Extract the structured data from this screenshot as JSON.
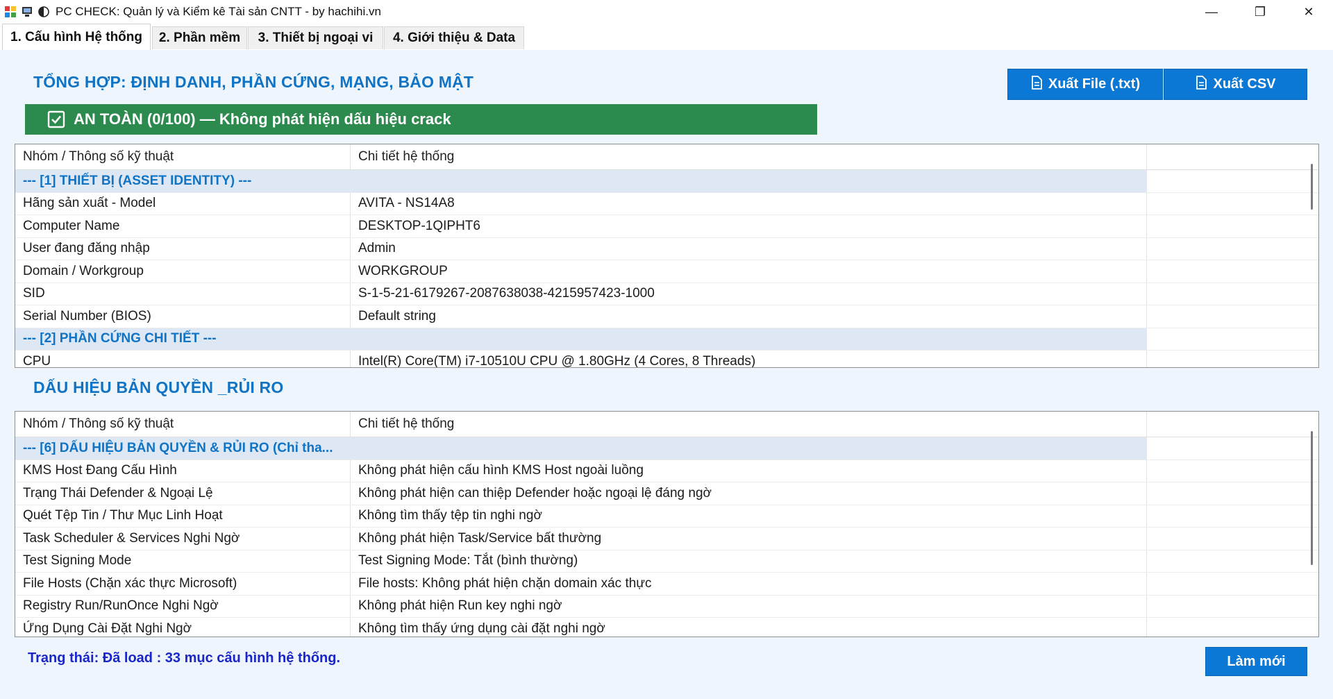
{
  "window": {
    "title": "PC CHECK: Quản lý và Kiểm kê Tài sản CNTT - by hachihi.vn",
    "controls": {
      "minimize": "—",
      "maximize": "❐",
      "close": "✕"
    }
  },
  "tabs": [
    {
      "label": "1. Cấu hình Hệ thống",
      "active": true
    },
    {
      "label": "2. Phần mềm",
      "active": false
    },
    {
      "label": "3. Thiết bị ngoại vi",
      "active": false
    },
    {
      "label": "4. Giới thiệu & Data",
      "active": false
    }
  ],
  "summary": {
    "title": "TỔNG HỢP: ĐỊNH DANH, PHẦN CỨNG, MẠNG, BẢO MẬT",
    "export_txt_label": "Xuất File (.txt)",
    "export_csv_label": "Xuất CSV",
    "safety_banner": "AN TOÀN (0/100) — Không phát hiện dấu hiệu crack",
    "columns": [
      "Nhóm / Thông số kỹ thuật",
      "Chi tiết hệ thống"
    ],
    "rows": [
      {
        "group": true,
        "name": "--- [1] THIẾT BỊ (ASSET IDENTITY) ---",
        "value": ""
      },
      {
        "group": false,
        "name": "Hãng sản xuất - Model",
        "value": "AVITA - NS14A8"
      },
      {
        "group": false,
        "name": "Computer Name",
        "value": "DESKTOP-1QIPHT6"
      },
      {
        "group": false,
        "name": "User đang đăng nhập",
        "value": "Admin"
      },
      {
        "group": false,
        "name": "Domain / Workgroup",
        "value": "WORKGROUP"
      },
      {
        "group": false,
        "name": "SID",
        "value": "S-1-5-21-6179267-2087638038-4215957423-1000"
      },
      {
        "group": false,
        "name": "Serial Number (BIOS)",
        "value": "Default string"
      },
      {
        "group": true,
        "name": "--- [2] PHẦN CỨNG CHI TIẾT ---",
        "value": ""
      },
      {
        "group": false,
        "name": "CPU",
        "value": "Intel(R) Core(TM) i7-10510U CPU @ 1.80GHz (4 Cores, 8 Threads)"
      }
    ]
  },
  "license": {
    "title": "DẤU HIỆU BẢN QUYỀN _RỦI RO",
    "columns": [
      "Nhóm / Thông số kỹ thuật",
      "Chi tiết hệ thống"
    ],
    "rows": [
      {
        "group": true,
        "name": "--- [6] DẤU HIỆU BẢN QUYỀN & RỦI RO (Chỉ tha...",
        "value": ""
      },
      {
        "group": false,
        "name": "KMS Host Đang Cấu Hình",
        "value": "Không phát hiện cấu hình KMS Host ngoài luồng"
      },
      {
        "group": false,
        "name": "Trạng Thái Defender & Ngoại Lệ",
        "value": "Không phát hiện can thiệp Defender hoặc ngoại lệ đáng ngờ"
      },
      {
        "group": false,
        "name": "Quét Tệp Tin / Thư Mục Linh Hoạt",
        "value": "Không tìm thấy tệp tin nghi ngờ"
      },
      {
        "group": false,
        "name": "Task Scheduler & Services Nghi Ngờ",
        "value": "Không phát hiện Task/Service bất thường"
      },
      {
        "group": false,
        "name": "Test Signing Mode",
        "value": "Test Signing Mode: Tắt (bình thường)"
      },
      {
        "group": false,
        "name": "File Hosts (Chặn xác thực Microsoft)",
        "value": "File hosts: Không phát hiện chặn domain xác thực"
      },
      {
        "group": false,
        "name": "Registry Run/RunOnce Nghi Ngờ",
        "value": "Không phát hiện Run key nghi ngờ"
      },
      {
        "group": false,
        "name": "Ứng Dụng Cài Đặt Nghi Ngờ",
        "value": "Không tìm thấy ứng dụng cài đặt nghi ngờ"
      }
    ]
  },
  "footer": {
    "status": "Trạng thái: Đã load : 33 mục cấu hình hệ thống.",
    "refresh_label": "Làm mới"
  },
  "colors": {
    "accent": "#0a78d4",
    "title_blue": "#1173c4",
    "safe_green": "#2d8a4e",
    "status_blue": "#1a26c8",
    "panel_bg": "#eef5fc",
    "group_row_bg": "#dde8f4"
  }
}
